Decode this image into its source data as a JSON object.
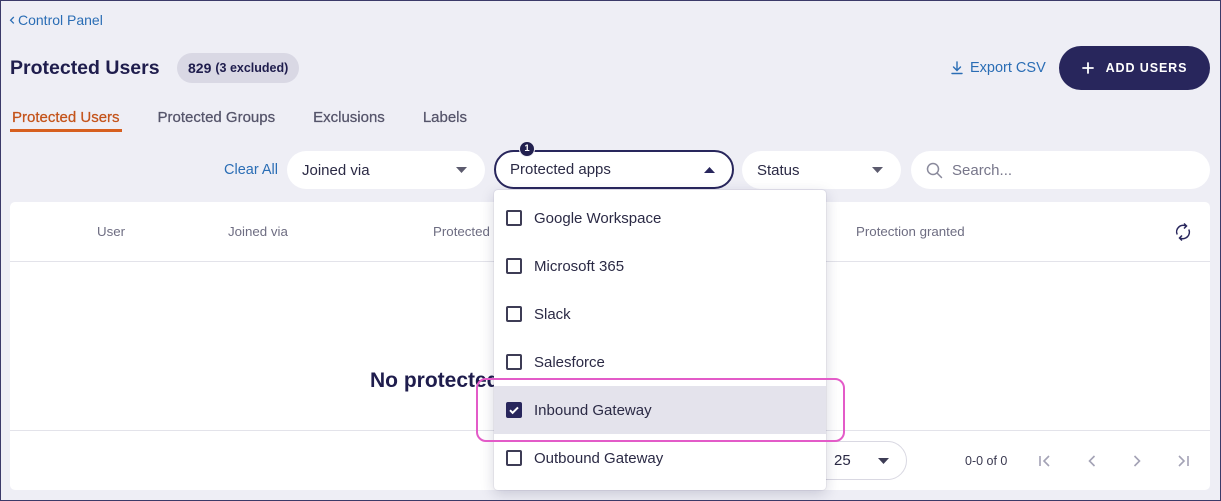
{
  "nav": {
    "back_label": "Control Panel",
    "back_icon": "chevron-left-icon"
  },
  "header": {
    "title": "Protected Users",
    "count": "829",
    "excluded": "(3 excluded)",
    "export_label": "Export CSV",
    "export_icon": "download-icon",
    "add_label": "ADD USERS",
    "add_icon": "plus-icon"
  },
  "tabs": [
    {
      "label": "Protected Users",
      "active": true
    },
    {
      "label": "Protected Groups",
      "active": false
    },
    {
      "label": "Exclusions",
      "active": false
    },
    {
      "label": "Labels",
      "active": false
    }
  ],
  "filters": {
    "clear_label": "Clear All",
    "joined_via": {
      "label": "Joined via",
      "icon": "caret-down-icon"
    },
    "protected_apps": {
      "label": "Protected apps",
      "selected_count": "1",
      "open": true,
      "icon": "caret-up-icon"
    },
    "status": {
      "label": "Status",
      "icon": "caret-down-icon"
    },
    "search": {
      "placeholder": "Search...",
      "value": "",
      "icon": "search-icon"
    }
  },
  "table": {
    "columns": [
      "User",
      "Joined via",
      "Protected",
      "Protection granted"
    ],
    "refresh_icon": "refresh-icon",
    "rows": [],
    "empty_message": "No protected"
  },
  "pagination": {
    "rows_per_page": "25",
    "range": "0-0 of 0",
    "icons": [
      "first-page-icon",
      "prev-page-icon",
      "next-page-icon",
      "last-page-icon"
    ]
  },
  "protected_apps_menu": {
    "options": [
      {
        "label": "Google Workspace",
        "checked": false,
        "highlighted": false
      },
      {
        "label": "Microsoft 365",
        "checked": false,
        "highlighted": false
      },
      {
        "label": "Slack",
        "checked": false,
        "highlighted": false
      },
      {
        "label": "Salesforce",
        "checked": false,
        "highlighted": false
      },
      {
        "label": "Inbound Gateway",
        "checked": true,
        "highlighted": true
      },
      {
        "label": "Outbound Gateway",
        "checked": false,
        "highlighted": false
      }
    ]
  },
  "colors": {
    "background": "#eeeef5",
    "brand_navy": "#28265c",
    "link_blue": "#2a6db5",
    "active_tab": "#c4531a",
    "annotation_pink": "#e35bc8"
  }
}
